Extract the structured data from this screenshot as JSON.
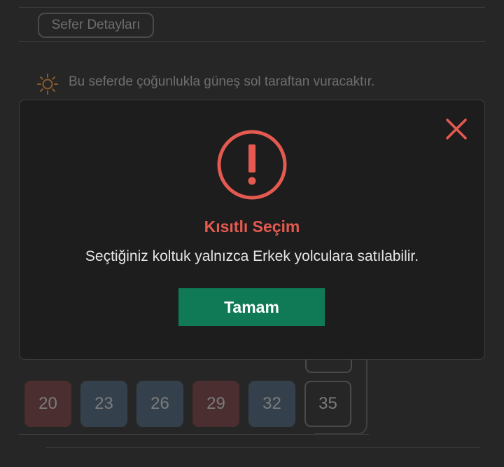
{
  "trip": {
    "details_button_label": "Sefer Detayları",
    "sun_note": "Bu seferde çoğunlukla güneş sol taraftan vuracaktır."
  },
  "seats": [
    {
      "number": "20",
      "status": "female"
    },
    {
      "number": "23",
      "status": "male"
    },
    {
      "number": "26",
      "status": "male"
    },
    {
      "number": "29",
      "status": "female"
    },
    {
      "number": "32",
      "status": "male"
    },
    {
      "number": "35",
      "status": "empty"
    }
  ],
  "modal": {
    "title": "Kısıtlı Seçim",
    "message": "Seçtiğiniz koltuk yalnızca Erkek yolculara satılabilir.",
    "ok_label": "Tamam",
    "icons": {
      "warning": "exclamation-circle-icon",
      "close": "close-icon"
    }
  },
  "colors": {
    "background": "#262626",
    "modal_background": "#1d1d1d",
    "danger": "#e45a50",
    "primary_button": "#0f7a55",
    "female_seat": "#4a2e30",
    "male_seat": "#34414d"
  }
}
